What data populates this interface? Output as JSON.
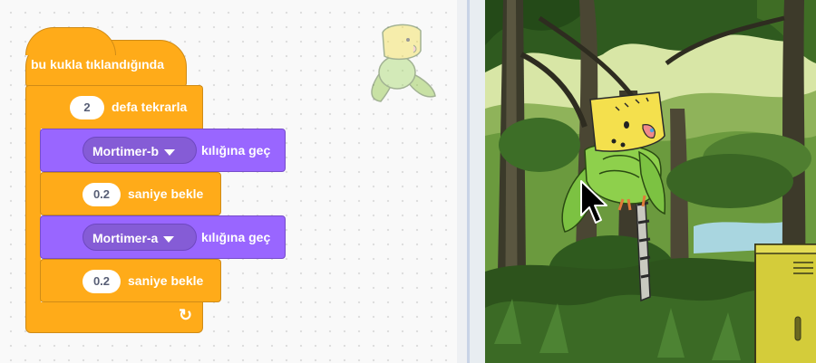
{
  "script": {
    "hat_label": "bu kukla tıklandığında",
    "repeat": {
      "value": "2",
      "label": "defa tekrarla"
    },
    "steps": [
      {
        "costume": "Mortimer-b",
        "label": "kılığına geç"
      },
      {
        "value": "0.2",
        "label": "saniye bekle"
      },
      {
        "costume": "Mortimer-a",
        "label": "kılığına geç"
      },
      {
        "value": "0.2",
        "label": "saniye bekle"
      }
    ],
    "loop_arrow_icon": "loop-arrow-icon"
  },
  "colors": {
    "events": "#ffab19",
    "control": "#ffab19",
    "looks": "#9966ff",
    "looks_input": "#855cd6"
  },
  "stage": {
    "sprite": "green-parakeet",
    "cursor_icon": "mouse-pointer-icon"
  }
}
